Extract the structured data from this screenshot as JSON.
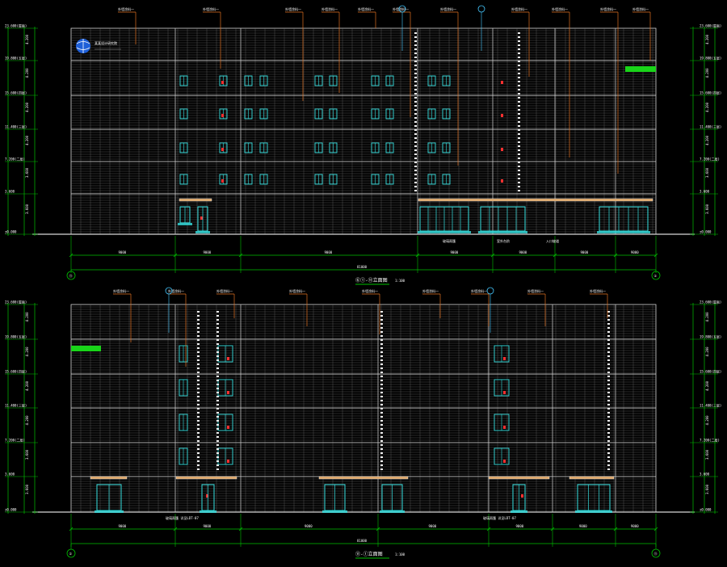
{
  "colors": {
    "background": "#000000",
    "grid_green": "#00c000",
    "facade_white": "#d8d8d8",
    "facade_grey": "#7a7a7a",
    "window_cyan": "#35e0e0",
    "leader_orange": "#e07020",
    "accent_red": "#ff3030",
    "highlight_green": "#19d419",
    "annotation_cyan": "#46c8ff"
  },
  "drawing_top": {
    "caption": "⑥①-⑪立面图",
    "scale": "1:100",
    "grid_bubbles": [
      "⑪",
      "①"
    ],
    "elevation_labels": [
      "23.600(屋面)",
      "19.800(五层)",
      "15.600(四层)",
      "11.400(三层)",
      "7.200(二层)",
      "3.600",
      "±0.000"
    ],
    "dimension_labels": [
      "4.200",
      "4.200",
      "4.200",
      "4.200",
      "3.600",
      "3.600"
    ],
    "bay_dims": [
      "9000",
      "9000",
      "9000",
      "9000",
      "9000",
      "9000",
      "9000",
      "9000",
      "9000"
    ],
    "overall_dim": "81000",
    "callouts": [
      "外墙涂料一",
      "外墙涂料一",
      "外墙涂料一",
      "外墙涂料一",
      "外墙涂料一",
      "外墙涂料一",
      "外墙涂料一",
      "外墙涂料一",
      "外墙涂料一",
      "外墙涂料一"
    ],
    "bottom_notes": [
      "玻璃雨篷",
      "室外台阶",
      "入口坡道"
    ],
    "logo_text": "某某设计研究院"
  },
  "drawing_bottom": {
    "caption": "⑪-①立面图",
    "scale": "1:100",
    "grid_bubbles": [
      "①",
      "⑪"
    ],
    "elevation_labels": [
      "23.600(屋面)",
      "19.800(五层)",
      "15.600(四层)",
      "11.400(三层)",
      "7.200(二层)",
      "3.600",
      "±0.000"
    ],
    "dimension_labels": [
      "4.200",
      "4.200",
      "4.200",
      "4.200",
      "3.600",
      "3.600"
    ],
    "bay_dims": [
      "9000",
      "9000",
      "9000",
      "9000",
      "9000",
      "9000",
      "9000",
      "9000",
      "9000"
    ],
    "overall_dim": "81000",
    "callouts": [
      "外墙涂料一",
      "外墙涂料一",
      "外墙涂料一",
      "外墙涂料一",
      "外墙涂料一",
      "外墙涂料一",
      "外墙涂料一",
      "外墙涂料一"
    ],
    "bottom_notes": [
      "玻璃雨篷 详见LDT-07",
      "玻璃雨篷 详见LDT-07"
    ]
  }
}
